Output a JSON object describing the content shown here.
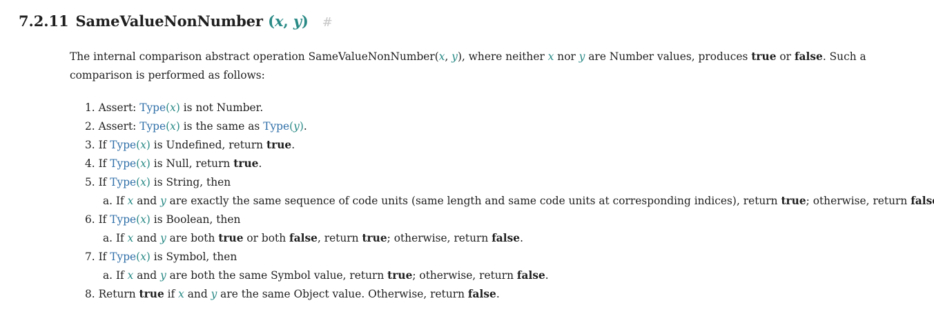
{
  "heading": {
    "number": "7.2.11",
    "name": "SameValueNonNumber",
    "open_paren": "(",
    "param1": "x",
    "comma": ",",
    "param2": "y",
    "close_paren": ")",
    "anchor": "#"
  },
  "intro": {
    "t1": "The internal comparison abstract operation SameValueNonNumber(",
    "x": "x",
    "comma": ", ",
    "y": "y",
    "t2": "), where neither ",
    "x2": "x",
    "nor": " nor ",
    "y2": "y",
    "t3": " are Number values, produces ",
    "true": "true",
    "or": " or ",
    "false": "false",
    "t4": ". Such a comparison is performed as follows:"
  },
  "steps": {
    "s1": {
      "num": "1. ",
      "a": "Assert: ",
      "type": "Type",
      "x": "x",
      "rest": " is not Number."
    },
    "s2": {
      "num": "2. ",
      "a": "Assert: ",
      "type1": "Type",
      "x": "x",
      "mid": " is the same as ",
      "type2": "Type",
      "y": "y",
      "end": "."
    },
    "s3": {
      "num": "3. ",
      "a": "If ",
      "type": "Type",
      "x": "x",
      "mid": " is Undefined, return ",
      "bold": "true",
      "end": "."
    },
    "s4": {
      "num": "4. ",
      "a": "If ",
      "type": "Type",
      "x": "x",
      "mid": " is Null, return ",
      "bold": "true",
      "end": "."
    },
    "s5": {
      "num": "5. ",
      "a": "If ",
      "type": "Type",
      "x": "x",
      "mid": " is String, then",
      "sub": {
        "num": "a. ",
        "a": "If ",
        "x": "x",
        "and": " and ",
        "y": "y",
        "mid": " are exactly the same sequence of code units (same length and same code units at corresponding indices), return ",
        "true": "true",
        "mid2": "; otherwise, return ",
        "false": "false",
        "end": "."
      }
    },
    "s6": {
      "num": "6. ",
      "a": "If ",
      "type": "Type",
      "x": "x",
      "mid": " is Boolean, then",
      "sub": {
        "num": "a. ",
        "a": "If ",
        "x": "x",
        "and": " and ",
        "y": "y",
        "mid": " are both ",
        "true1": "true",
        "or": " or both ",
        "false1": "false",
        "ret": ", return ",
        "true2": "true",
        "mid2": "; otherwise, return ",
        "false2": "false",
        "end": "."
      }
    },
    "s7": {
      "num": "7. ",
      "a": "If ",
      "type": "Type",
      "x": "x",
      "mid": " is Symbol, then",
      "sub": {
        "num": "a. ",
        "a": "If ",
        "x": "x",
        "and": " and ",
        "y": "y",
        "mid": " are both the same Symbol value, return ",
        "true": "true",
        "mid2": "; otherwise, return ",
        "false": "false",
        "end": "."
      }
    },
    "s8": {
      "num": "8. ",
      "a": "Return ",
      "true": "true",
      "if": " if ",
      "x": "x",
      "and": " and ",
      "y": "y",
      "mid": " are the same Object value. Otherwise, return ",
      "false": "false",
      "end": "."
    }
  }
}
